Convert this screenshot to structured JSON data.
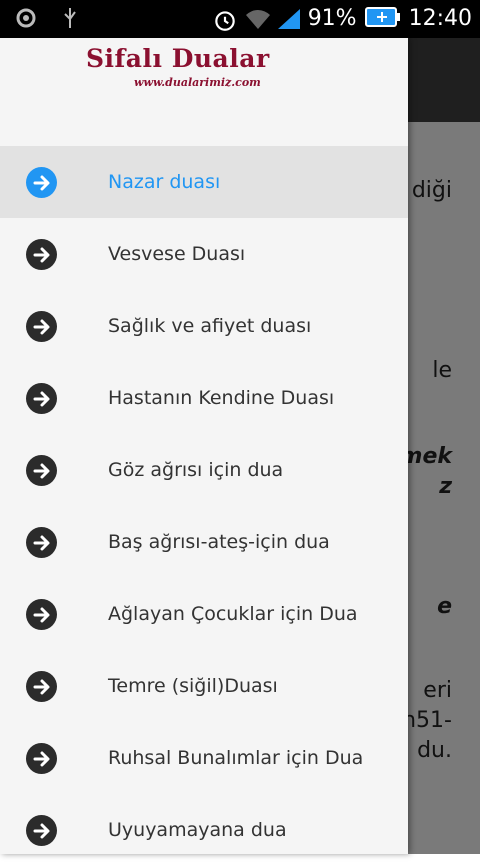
{
  "status_bar": {
    "battery": "91%",
    "time": "12:40",
    "icons": [
      "settings-icon",
      "usb-icon",
      "alarm-icon",
      "wifi-icon",
      "signal-icon",
      "battery-charging-icon"
    ]
  },
  "background_text": [
    "diği",
    "le",
    "mek",
    "z",
    "e",
    "eri",
    "n51-",
    "du."
  ],
  "drawer": {
    "logo_title": "Sifalı Dualar",
    "logo_url": "www.dualarimiz.com",
    "items": [
      {
        "label": "Nazar duası",
        "active": true
      },
      {
        "label": "Vesvese Duası"
      },
      {
        "label": "Sağlık ve afiyet duası"
      },
      {
        "label": "Hastanın Kendine Duası"
      },
      {
        "label": "Göz ağrısı için dua"
      },
      {
        "label": "Baş ağrısı-ateş-için dua"
      },
      {
        "label": "Ağlayan Çocuklar için Dua"
      },
      {
        "label": "Temre (siğil)Duası"
      },
      {
        "label": "Ruhsal Bunalımlar için Dua"
      },
      {
        "label": "Uyuyamayana dua"
      }
    ],
    "colors": {
      "active": "#2196f3",
      "brand": "#8b1030"
    }
  }
}
